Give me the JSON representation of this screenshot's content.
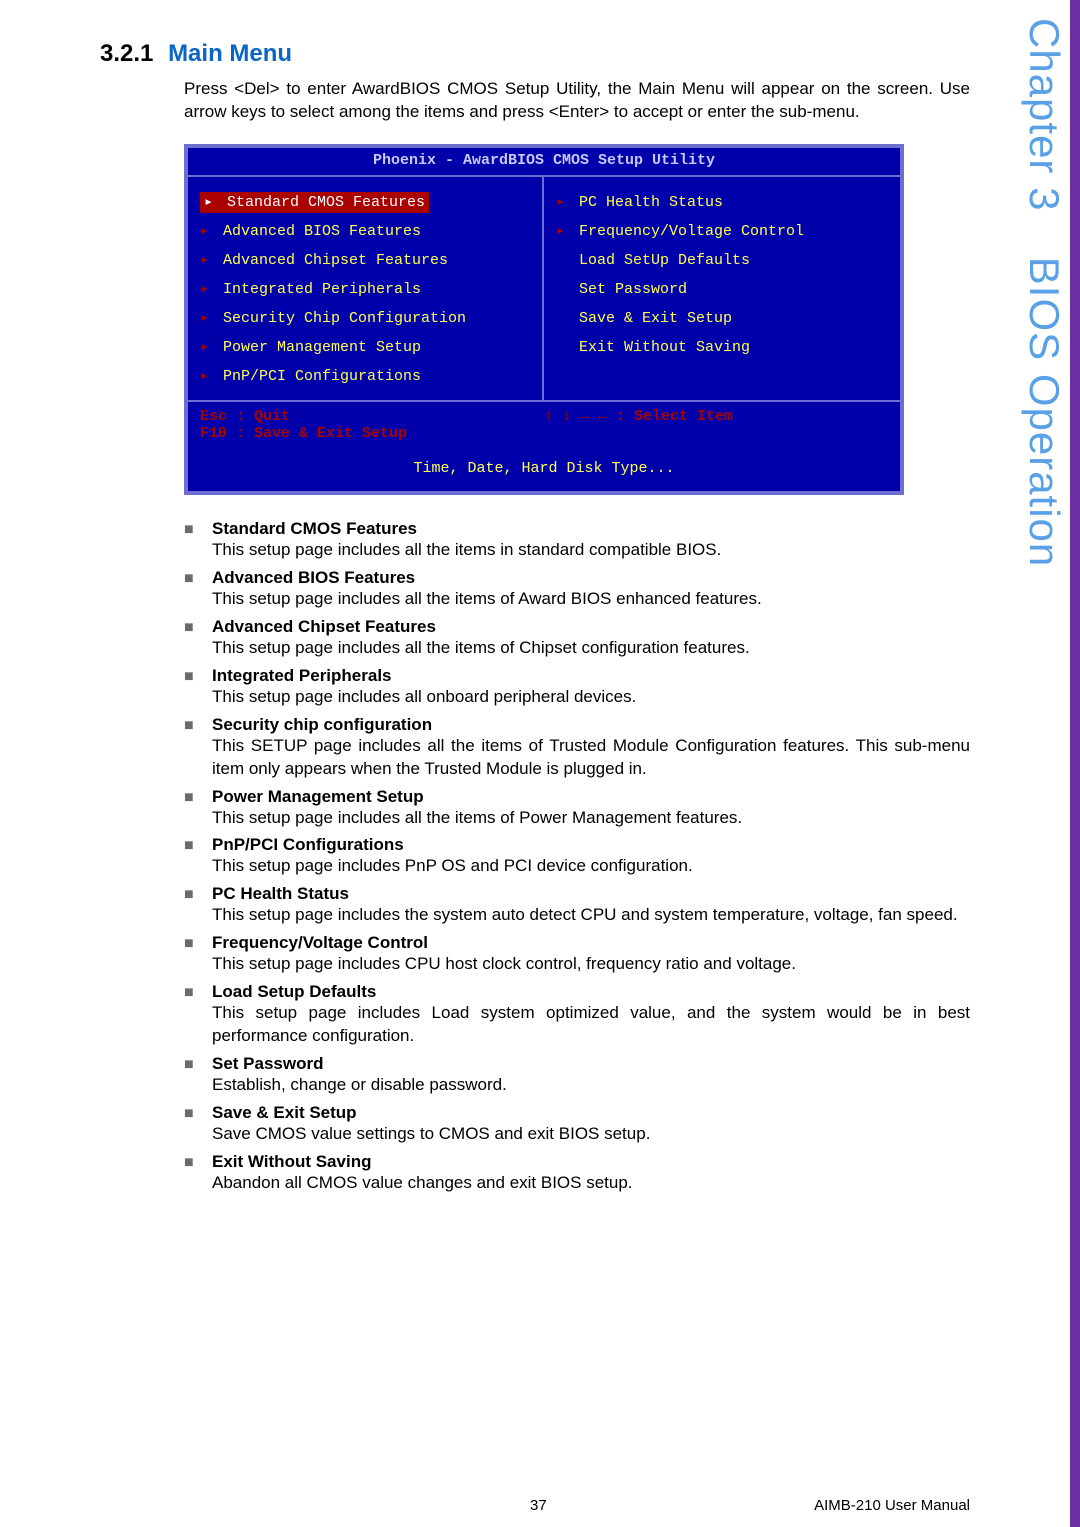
{
  "side": {
    "chapter": "Chapter 3",
    "operation": "BIOS Operation"
  },
  "section": {
    "number": "3.2.1",
    "title": "Main Menu"
  },
  "intro": "Press <Del> to enter AwardBIOS CMOS Setup Utility, the Main Menu will appear on the screen. Use arrow keys to select among the items and press <Enter> to accept or enter the sub-menu.",
  "bios": {
    "title": "Phoenix - AwardBIOS CMOS Setup Utility",
    "left": [
      "Standard CMOS Features",
      "Advanced BIOS Features",
      "Advanced Chipset Features",
      "Integrated Peripherals",
      "Security Chip Configuration",
      "Power Management Setup",
      "PnP/PCI Configurations"
    ],
    "right": [
      {
        "t": "PC Health Status",
        "a": true
      },
      {
        "t": "Frequency/Voltage Control",
        "a": true
      },
      {
        "t": "Load SetUp Defaults",
        "a": false
      },
      {
        "t": "Set Password",
        "a": false
      },
      {
        "t": "Save & Exit Setup",
        "a": false
      },
      {
        "t": "Exit Without Saving",
        "a": false
      }
    ],
    "hint_left1": "Esc : Quit",
    "hint_left2": "F10 : Save & Exit Setup",
    "hint_right": "↑ ↓ → ←   : Select Item",
    "footer": "Time, Date, Hard Disk Type..."
  },
  "features": [
    {
      "title": "Standard CMOS Features",
      "desc": "This setup page includes all the items in standard compatible BIOS."
    },
    {
      "title": "Advanced BIOS Features",
      "desc": "This setup page includes all the items of Award BIOS enhanced features."
    },
    {
      "title": "Advanced Chipset Features",
      "desc": "This setup page includes all the items of Chipset configuration features."
    },
    {
      "title": "Integrated Peripherals",
      "desc": "This setup page includes all onboard peripheral devices."
    },
    {
      "title": "Security chip configuration",
      "desc": "This SETUP page includes all the items of Trusted Module Configuration features. This sub-menu item only appears when the Trusted Module is plugged in."
    },
    {
      "title": "Power Management Setup",
      "desc": "This setup page includes all the items of Power Management features."
    },
    {
      "title": "PnP/PCI Configurations",
      "desc": "This setup page includes PnP OS and PCI device configuration."
    },
    {
      "title": "PC Health Status",
      "desc": "This setup page includes the system auto detect CPU and system temperature, voltage, fan speed."
    },
    {
      "title": "Frequency/Voltage Control",
      "desc": "This setup page includes CPU host clock control, frequency ratio and voltage."
    },
    {
      "title": "Load Setup Defaults",
      "desc": "This setup page includes Load system optimized value, and the system would be in best performance configuration."
    },
    {
      "title": "Set Password",
      "desc": "Establish, change or disable password."
    },
    {
      "title": "Save & Exit Setup",
      "desc": "Save CMOS value settings to CMOS and exit BIOS setup."
    },
    {
      "title": "Exit Without Saving",
      "desc": "Abandon all CMOS value changes and exit BIOS setup."
    }
  ],
  "footer": {
    "page": "37",
    "manual": "AIMB-210 User Manual"
  }
}
